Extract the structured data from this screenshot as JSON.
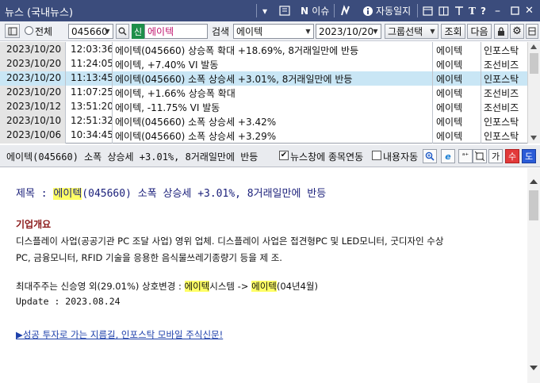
{
  "window": {
    "title": "뉴스 (국내뉴스)",
    "issue_label": "이슈",
    "autosave_label": "자동일지"
  },
  "toolbar": {
    "all_label": "전체",
    "code_value": "045660",
    "shin_label": "신",
    "stock_name": "에이텍",
    "search_label": "검색",
    "search_value": "에이텍",
    "date_value": "2023/10/20",
    "group_label": "그룹선택",
    "query_button": "조회",
    "next_button": "다음"
  },
  "news_list": [
    {
      "date": "2023/10/20",
      "time": "12:03:36",
      "title": "에이텍(045660) 상승폭 확대 +18.69%, 8거래일만에 반등",
      "stock": "에이텍",
      "source": "인포스탁"
    },
    {
      "date": "2023/10/20",
      "time": "11:24:05",
      "title": "에이텍, +7.40% VI 발동",
      "stock": "에이텍",
      "source": "조선비즈"
    },
    {
      "date": "2023/10/20",
      "time": "11:13:45",
      "title": "에이텍(045660) 소폭 상승세 +3.01%, 8거래일만에 반등",
      "stock": "에이텍",
      "source": "인포스탁"
    },
    {
      "date": "2023/10/20",
      "time": "11:07:25",
      "title": "에이텍, +1.66% 상승폭 확대",
      "stock": "에이텍",
      "source": "조선비즈"
    },
    {
      "date": "2023/10/12",
      "time": "13:51:20",
      "title": "에이텍, -11.75% VI 발동",
      "stock": "에이텍",
      "source": "조선비즈"
    },
    {
      "date": "2023/10/10",
      "time": "12:51:32",
      "title": "에이텍(045660) 소폭 상승세 +3.42%",
      "stock": "에이텍",
      "source": "인포스탁"
    },
    {
      "date": "2023/10/06",
      "time": "10:34:45",
      "title": "에이텍(045660) 소폭 상승세 +3.29%",
      "stock": "에이텍",
      "source": "인포스탁"
    }
  ],
  "headline_bar": {
    "headline": "에이텍(045660) 소폭 상승세 +3.01%, 8거래일만에 반등",
    "link_label": "뉴스창에 종목연동",
    "auto_label": "내용자동",
    "ga_label": "가",
    "su_label": "수",
    "do_label": "도"
  },
  "article": {
    "subject_prefix": "제목 : ",
    "subject_highlight": "에이텍",
    "subject_rest": "(045660) 소폭 상승세 +3.01%, 8거래일만에 반등",
    "section_title": "기업개요",
    "overview_line1": "디스플레이 사업(공공기관 PC 조달 사업) 영위 업체. 디스플레이 사업은 접견형PC 및 LED모니터, 굿디자인 수상",
    "overview_line2": "PC, 금융모니터, RFID 기술을 응용한 음식물쓰레기종량기 등을 제 조.",
    "holder_prefix": "최대주주는 신승영 외(29.01%) 상호변경 : ",
    "holder_hl1": "에이텍",
    "holder_mid": "시스템 -> ",
    "holder_hl2": "에이텍",
    "holder_suffix": "(04년4월)",
    "update_line": "Update : 2023.08.24",
    "promo_link": "▶성공 투자로 가는 지름길, 인포스탁 모바일 주식신문!"
  },
  "colors": {
    "titlebar": "#3b4c7c",
    "selected_row": "#c9e6f5",
    "highlight": "#ffff66",
    "subject_text": "#1a1f7a",
    "section_title": "#8b1a1a",
    "link": "#1c3faa"
  }
}
